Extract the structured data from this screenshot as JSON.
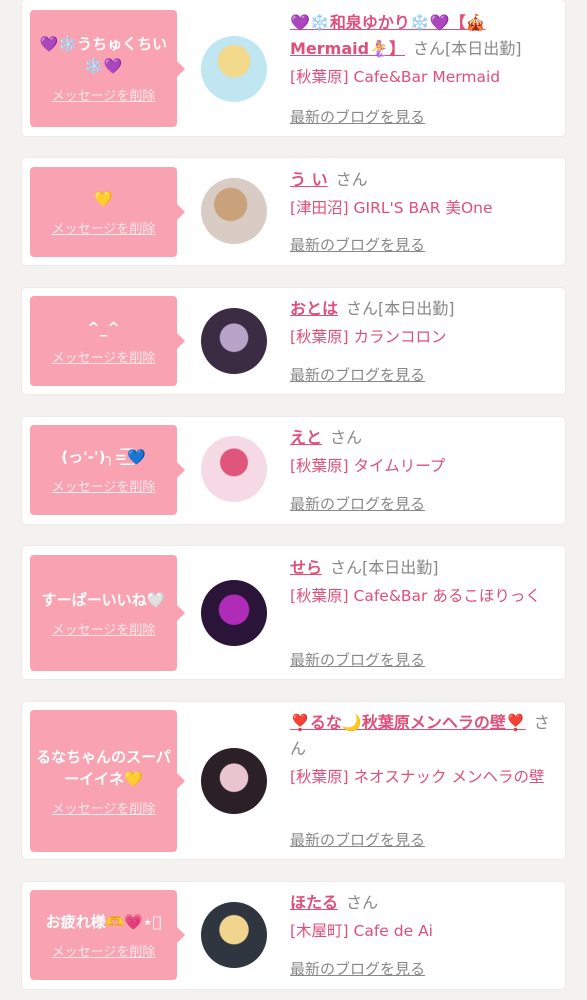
{
  "common": {
    "delete_label": "メッセージを削除",
    "san_label": "さん",
    "blog_label": "最新のブログを見る"
  },
  "items": [
    {
      "message": "💜❄️うちゅくちい❄️💜",
      "name": "💜❄️和泉ゆかり❄️💜【🎪Mermaid🧜‍♀️】",
      "duty": "[本日出勤]",
      "shop": "[秋葉原] Cafe&Bar Mermaid",
      "avatar_colors": [
        "#bfe6f1",
        "#f3d98c"
      ]
    },
    {
      "message": "💛",
      "name": "う い",
      "duty": "",
      "shop": "[津田沼] GIRL'S BAR 美One",
      "avatar_colors": [
        "#d8ccc4",
        "#c9a27c"
      ]
    },
    {
      "message": "^_^",
      "name": "おとは",
      "duty": "[本日出勤]",
      "shop": "[秋葉原] カランコロン",
      "avatar_colors": [
        "#3b2c44",
        "#b9a4c9"
      ]
    },
    {
      "message": "(っ'-')╮=͟͟͞͞💙",
      "name": "えと",
      "duty": "",
      "shop": "[秋葉原] タイムリープ",
      "avatar_colors": [
        "#f5d9e4",
        "#e0557a"
      ]
    },
    {
      "message": "すーぱーいいね🤍",
      "name": "せら",
      "duty": "[本日出勤]",
      "shop": "[秋葉原] Cafe&Bar あるこほりっく",
      "avatar_colors": [
        "#2a1438",
        "#b02bb8"
      ]
    },
    {
      "message": "るなちゃんのスーパーイイネ💛",
      "name": "❣️るな🌙秋葉原メンヘラの壁❣️",
      "duty": "",
      "shop": "[秋葉原] ネオスナック メンヘラの壁",
      "avatar_colors": [
        "#2b2026",
        "#e9c6cf"
      ]
    },
    {
      "message": "お疲れ様🫶💗⋆͛",
      "name": "ほたる",
      "duty": "",
      "shop": "[木屋町] Cafe de Ai",
      "avatar_colors": [
        "#303640",
        "#f1d58e"
      ]
    }
  ]
}
